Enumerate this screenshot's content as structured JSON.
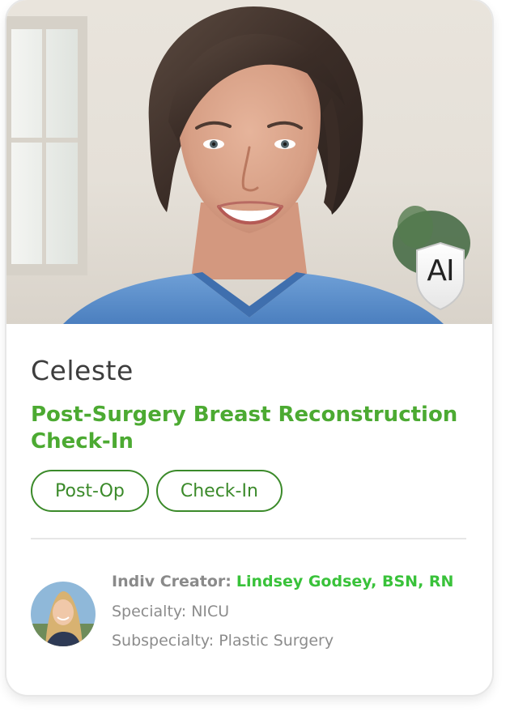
{
  "card": {
    "name": "Celeste",
    "title": "Post-Surgery Breast Reconstruction Check-In",
    "badge": "AI",
    "tags": [
      "Post-Op",
      "Check-In"
    ],
    "creator": {
      "label": "Indiv Creator:",
      "name": "Lindsey Godsey, BSN, RN",
      "specialty": "Specialty: NICU",
      "subspecialty": "Subspecialty: Plastic Surgery"
    }
  },
  "icons": {
    "badge": "shield-icon",
    "photo": "portrait-photo",
    "avatar": "creator-avatar"
  },
  "colors": {
    "accent_green": "#4caa32",
    "creator_green": "#39c23a",
    "tag_border": "#3b8a2a",
    "scrubs_blue": "#5a8fcb"
  }
}
